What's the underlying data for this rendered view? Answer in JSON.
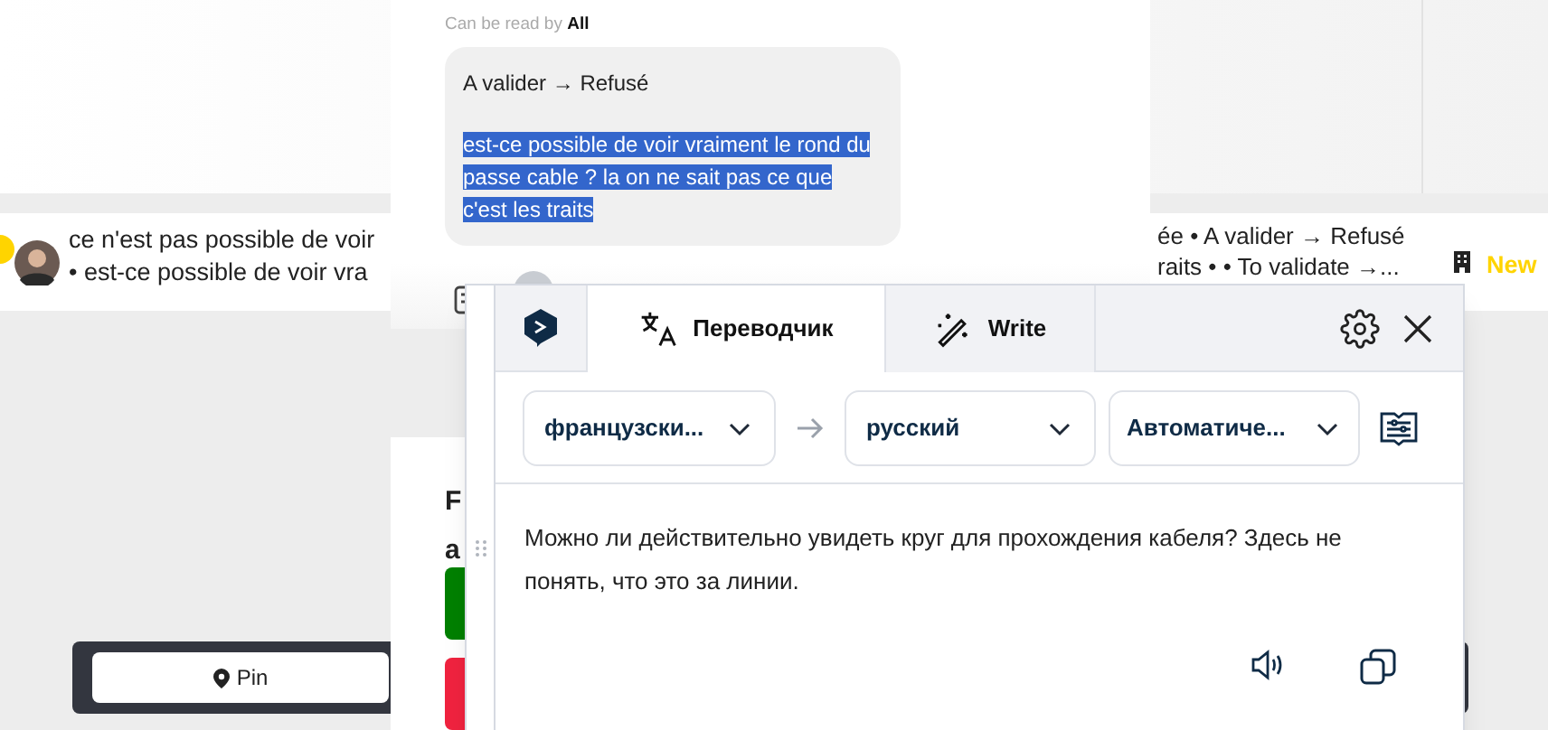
{
  "list_row": {
    "left_lines": [
      "ce n'est pas possible de voir",
      "• est-ce possible de voir vra"
    ],
    "right_lines": [
      "ée • A valider → Refusé",
      "raits • • To validate →..."
    ],
    "status": "New"
  },
  "map_bar": {
    "pin_button": "Pin"
  },
  "comment_panel": {
    "visibility_label": "Can be read by **All**",
    "status_change": "A valider → Refusé",
    "comment": "est-ce possible de voir vraiment le rond du passe cable ? la on ne sait pas ce que c'est les traits",
    "comment_selected": true
  },
  "action_panel": {
    "title_lines": [
      "F",
      "a"
    ],
    "buttons": [
      {
        "color": "#008000"
      },
      {
        "color": "#f0233f"
      }
    ]
  },
  "translator": {
    "tabs": [
      {
        "kind": "translate",
        "label": "Переводчик",
        "selected": true
      },
      {
        "kind": "write",
        "label": "Write",
        "selected": false
      }
    ],
    "source_language": "французски...",
    "target_language": "русский",
    "formality": "Автоматиче...",
    "translation": "Можно ли действительно увидеть круг для прохождения кабеля? Здесь не понять, что это за линии."
  }
}
